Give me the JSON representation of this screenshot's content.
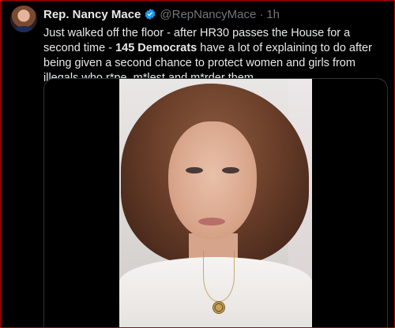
{
  "post": {
    "author_name": "Rep. Nancy Mace",
    "handle": "@RepNancyMace",
    "separator": "·",
    "time": "1h",
    "text_part1": "Just walked off the floor - after HR30 passes the House for a second time - ",
    "text_bold": "145 Democrats",
    "text_part2": " have a lot of explaining to do after being given a second chance to protect women and girls from illegals who r*pe, m*lest and m*rder them."
  },
  "colors": {
    "background": "#000000",
    "text": "#e7e9ea",
    "secondary_text": "#71767b",
    "verified_badge": "#1d9bf0",
    "media_border": "#2f3336",
    "frame_border": "#b80000"
  },
  "icons": {
    "verified": "verified-badge-icon"
  }
}
